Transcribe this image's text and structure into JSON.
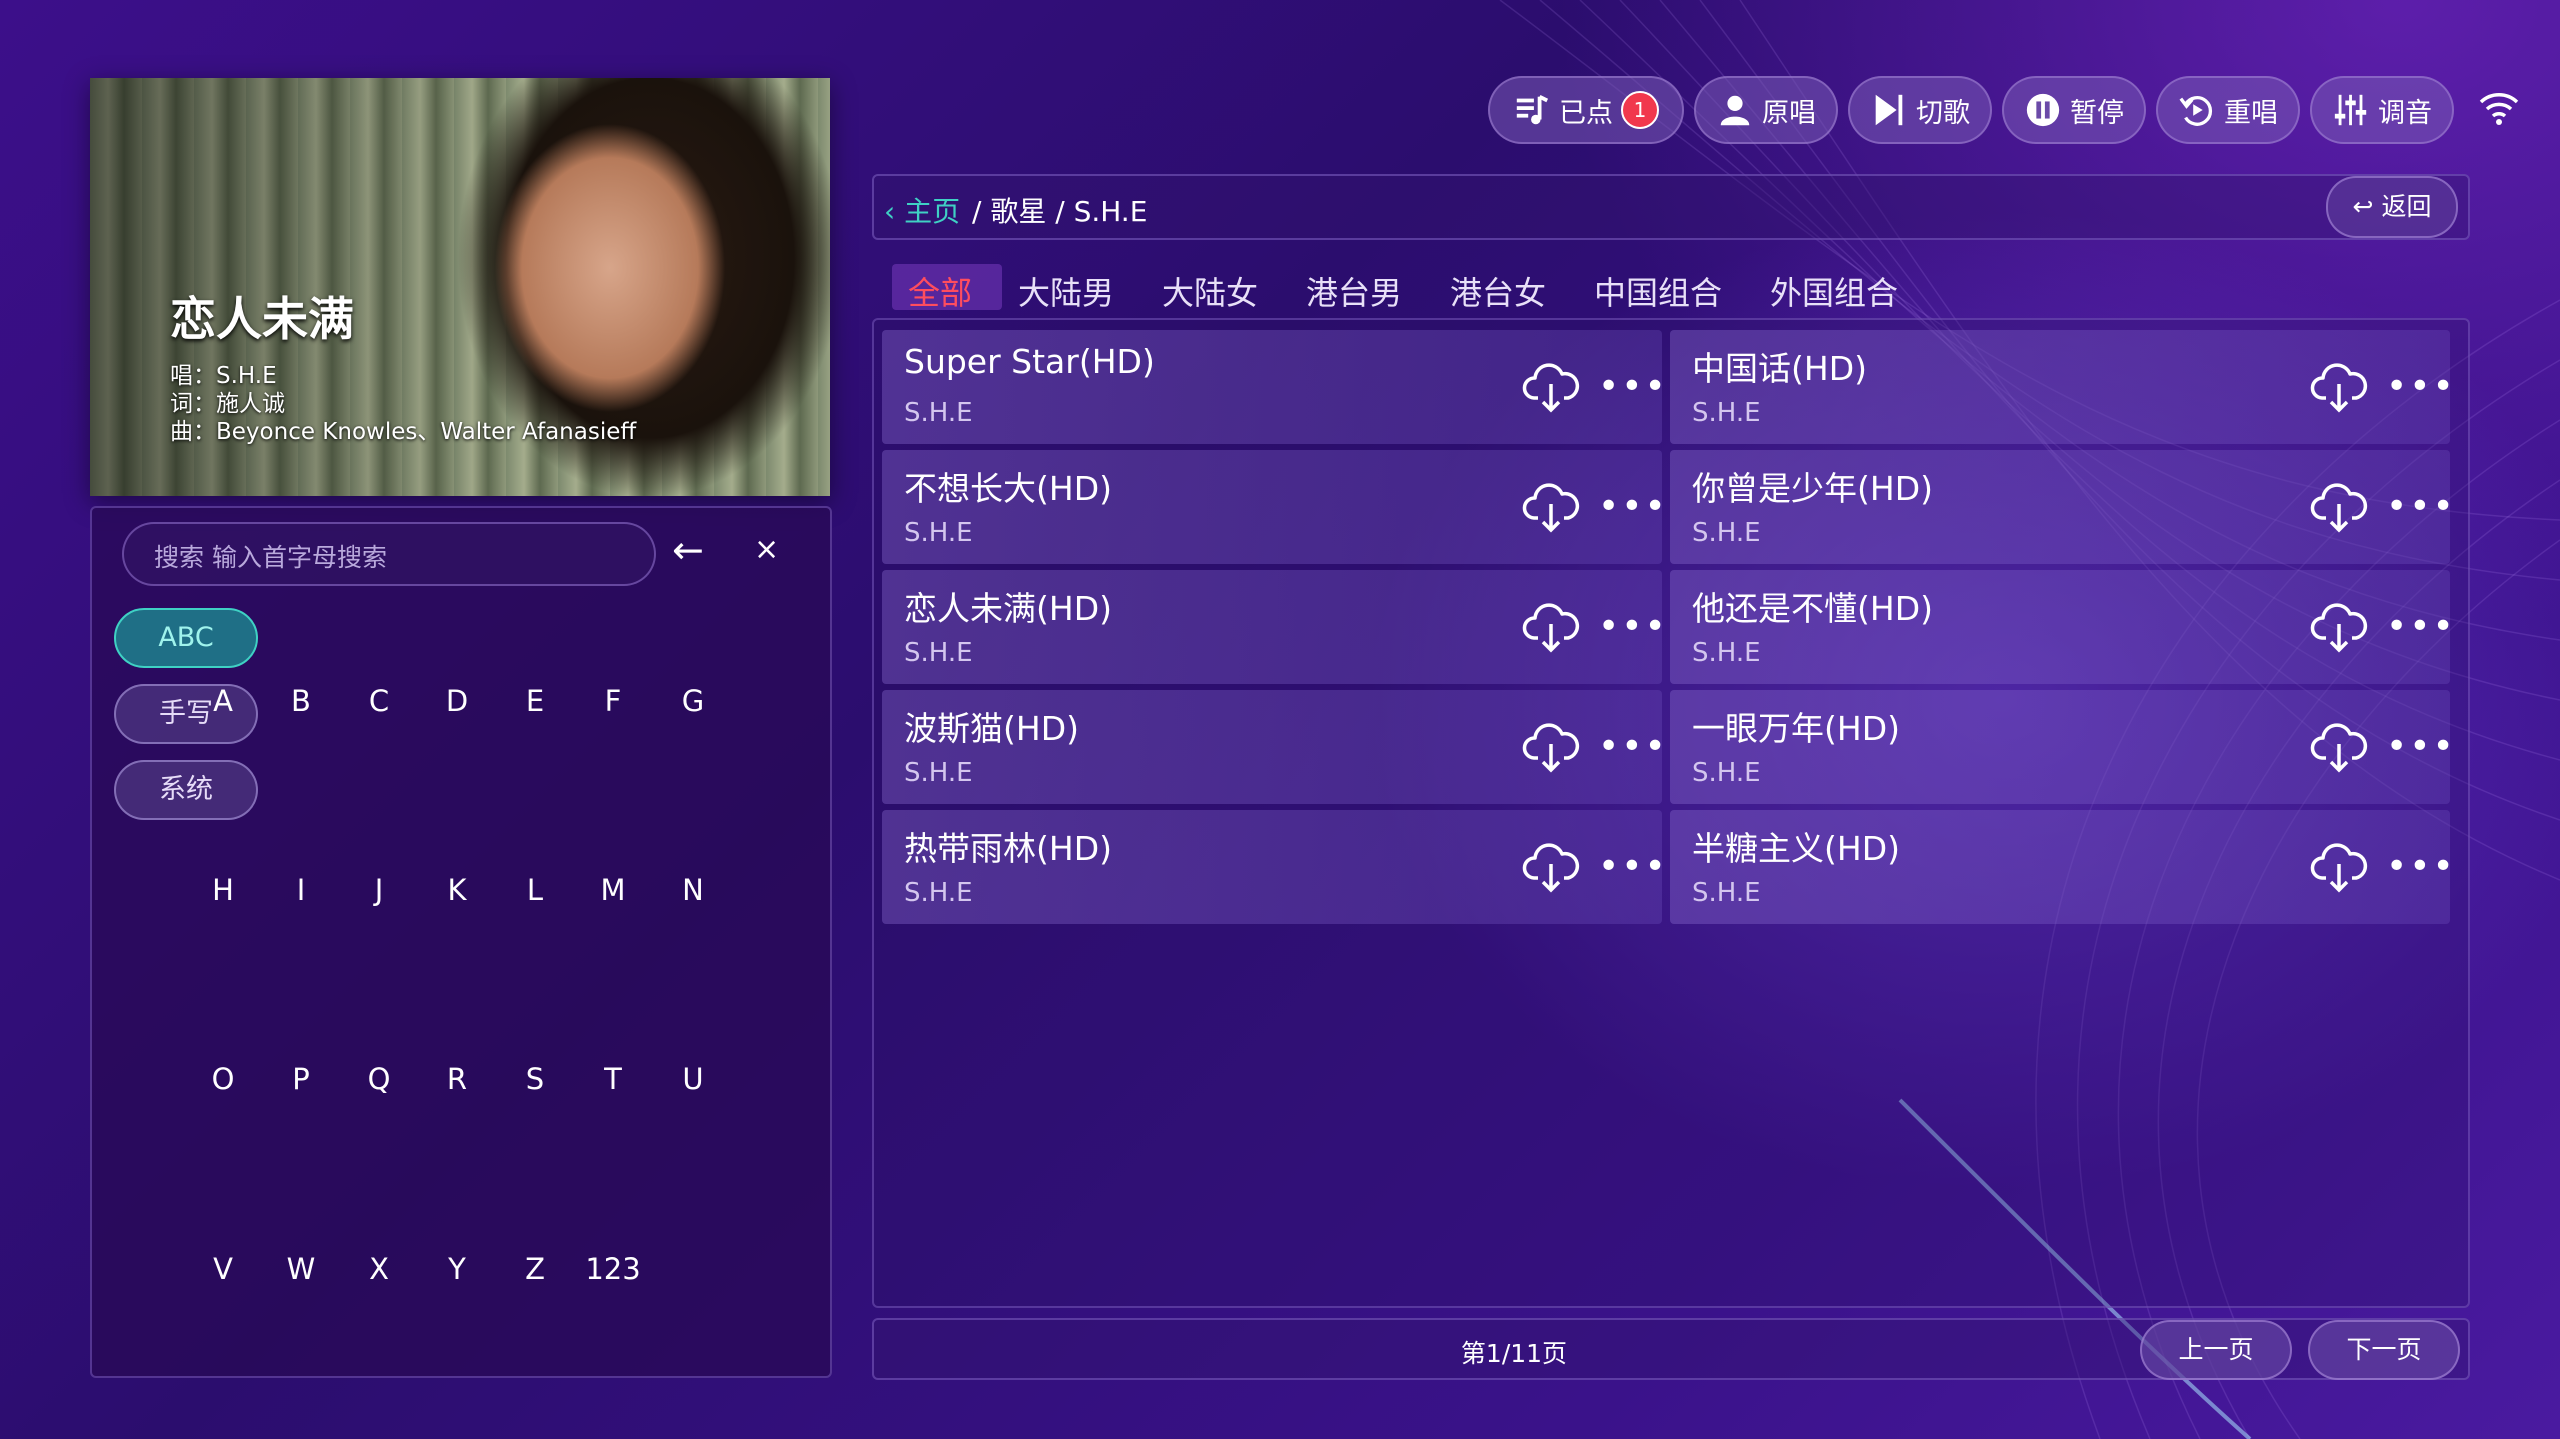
{
  "video": {
    "title": "恋人未满",
    "singer": "唱：S.H.E",
    "lyricist": "词：施人诚",
    "composer": "曲：Beyonce Knowles、Walter Afanasieff"
  },
  "search": {
    "placeholder": "搜索  输入首字母搜索"
  },
  "keyboard": {
    "modes": [
      "ABC",
      "手写",
      "系统"
    ],
    "rows": [
      [
        "A",
        "B",
        "C",
        "D",
        "E",
        "F",
        "G"
      ],
      [
        "H",
        "I",
        "J",
        "K",
        "L",
        "M",
        "N"
      ],
      [
        "O",
        "P",
        "Q",
        "R",
        "S",
        "T",
        "U"
      ],
      [
        "V",
        "W",
        "X",
        "Y",
        "Z",
        "123"
      ]
    ],
    "backspace": "←",
    "clear": "×"
  },
  "toolbar": {
    "ordered_label": "已点",
    "ordered_count": "1",
    "original_label": "原唱",
    "skip_label": "切歌",
    "pause_label": "暂停",
    "replay_label": "重唱",
    "tune_label": "调音"
  },
  "breadcrumb": {
    "home": "‹ 主页",
    "path": "/ 歌星 / S.H.E",
    "back": "↩ 返回"
  },
  "tabs": [
    "全部",
    "大陆男",
    "大陆女",
    "港台男",
    "港台女",
    "中国组合",
    "外国组合"
  ],
  "songs": [
    {
      "name": "Super Star(HD)",
      "artist": "S.H.E"
    },
    {
      "name": "中国话(HD)",
      "artist": "S.H.E"
    },
    {
      "name": "不想长大(HD)",
      "artist": "S.H.E"
    },
    {
      "name": "你曾是少年(HD)",
      "artist": "S.H.E"
    },
    {
      "name": "恋人未满(HD)",
      "artist": "S.H.E"
    },
    {
      "name": "他还是不懂(HD)",
      "artist": "S.H.E"
    },
    {
      "name": "波斯猫(HD)",
      "artist": "S.H.E"
    },
    {
      "name": "一眼万年(HD)",
      "artist": "S.H.E"
    },
    {
      "name": "热带雨林(HD)",
      "artist": "S.H.E"
    },
    {
      "name": "半糖主义(HD)",
      "artist": "S.H.E"
    }
  ],
  "more_glyph": "•••",
  "pagination": {
    "text": "第1/11页",
    "prev": "上一页",
    "next": "下一页"
  },
  "colors": {
    "accent": "#3fd1c4",
    "active_tab": "#ff4d5e",
    "badge": "#f1384d"
  }
}
